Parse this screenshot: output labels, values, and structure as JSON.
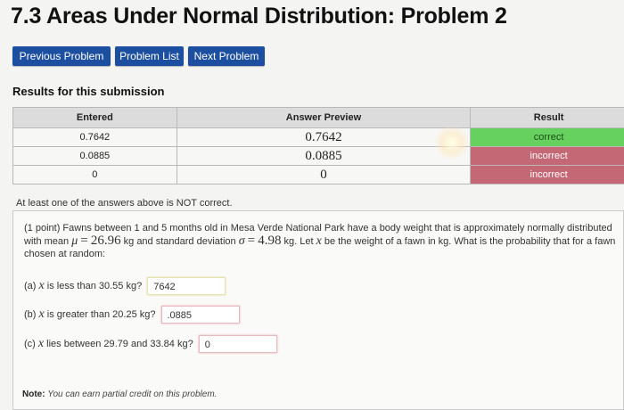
{
  "page": {
    "title": "7.3 Areas Under Normal Distribution: Problem 2"
  },
  "nav": {
    "previous": "Previous Problem",
    "list": "Problem List",
    "next": "Next Problem"
  },
  "results": {
    "heading": "Results for this submission",
    "headers": {
      "entered": "Entered",
      "preview": "Answer Preview",
      "result": "Result"
    },
    "rows": [
      {
        "entered": "0.7642",
        "preview": "0.7642",
        "result": "correct"
      },
      {
        "entered": "0.0885",
        "preview": "0.0885",
        "result": "incorrect"
      },
      {
        "entered": "0",
        "preview": "0",
        "result": "incorrect"
      }
    ],
    "message": "At least one of the answers above is NOT correct."
  },
  "problem": {
    "points": "(1 point)",
    "text_1": "Fawns between 1 and 5 months old in Mesa Verde National Park have a body weight that is approximately normally distributed with mean",
    "mu_symbol": "μ",
    "eq": "=",
    "mu_value": "26.96",
    "kg_1": "kg and standard deviation",
    "sigma_symbol": "σ",
    "sigma_value": "4.98",
    "text_2": "kg. Let",
    "x_symbol": "x",
    "text_3": "be the weight of a fawn in kg. What is the probability that for a fawn chosen at random:",
    "parts": [
      {
        "prefix": "(a)",
        "text": "is less than 30.55 kg?",
        "answer": "7642"
      },
      {
        "prefix": "(b)",
        "text": "is greater than 20.25 kg?",
        "answer": ".0885"
      },
      {
        "prefix": "(c)",
        "text": "lies between 29.79 and 33.84 kg?",
        "answer": "0"
      }
    ],
    "note_label": "Note:",
    "note_text": "You can earn partial credit on this problem."
  }
}
